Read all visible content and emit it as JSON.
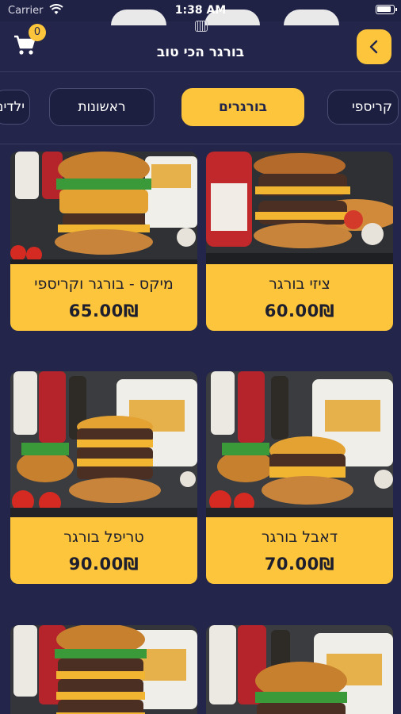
{
  "status_bar": {
    "carrier": "Carrier",
    "time": "1:38 AM"
  },
  "header": {
    "title": "בורגר הכי טוב",
    "cart_count": "0"
  },
  "tabs": [
    {
      "label": "ילדים",
      "active": false
    },
    {
      "label": "ראשונות",
      "active": false
    },
    {
      "label": "בורגרים",
      "active": true
    },
    {
      "label": "קריספי",
      "active": false
    }
  ],
  "products": [
    {
      "name": "ציזי בורגר",
      "price": "60.00₪"
    },
    {
      "name": "מיקס - בורגר וקריספי",
      "price": "65.00₪"
    },
    {
      "name": "דאבל בורגר",
      "price": "70.00₪"
    },
    {
      "name": "טריפל בורגר",
      "price": "90.00₪"
    }
  ],
  "colors": {
    "background": "#23264a",
    "accent": "#fdc53b",
    "text_dark": "#1e1f2e"
  }
}
